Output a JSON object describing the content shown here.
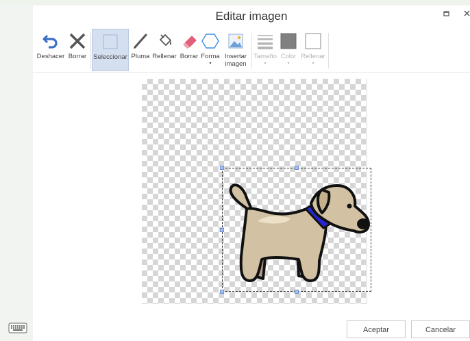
{
  "dialog": {
    "title": "Editar imagen"
  },
  "toolbar": {
    "undo_label": "Deshacer",
    "clear_label": "Borrar",
    "select_label": "Seleccionar",
    "pen_label": "Pluma",
    "fill_label": "Rellenar",
    "eraser_label": "Borrar",
    "shape_label": "Forma",
    "insert_image_label_line1": "Insertar",
    "insert_image_label_line2": "imagen",
    "size_label": "Tamaño",
    "color_label": "Color",
    "fill_color_label": "Rellenar",
    "caret": "▾"
  },
  "footer": {
    "accept_label": "Aceptar",
    "cancel_label": "Cancelar"
  },
  "colors": {
    "undo_icon": "#3a6fc4",
    "eraser_icon": "#e0607a",
    "shape_icon": "#3a8ee6",
    "active_tool_bg": "#d4dff0",
    "selected_color": "#808080",
    "dog_body": "#d2c2a3",
    "collar": "#2525d8"
  }
}
